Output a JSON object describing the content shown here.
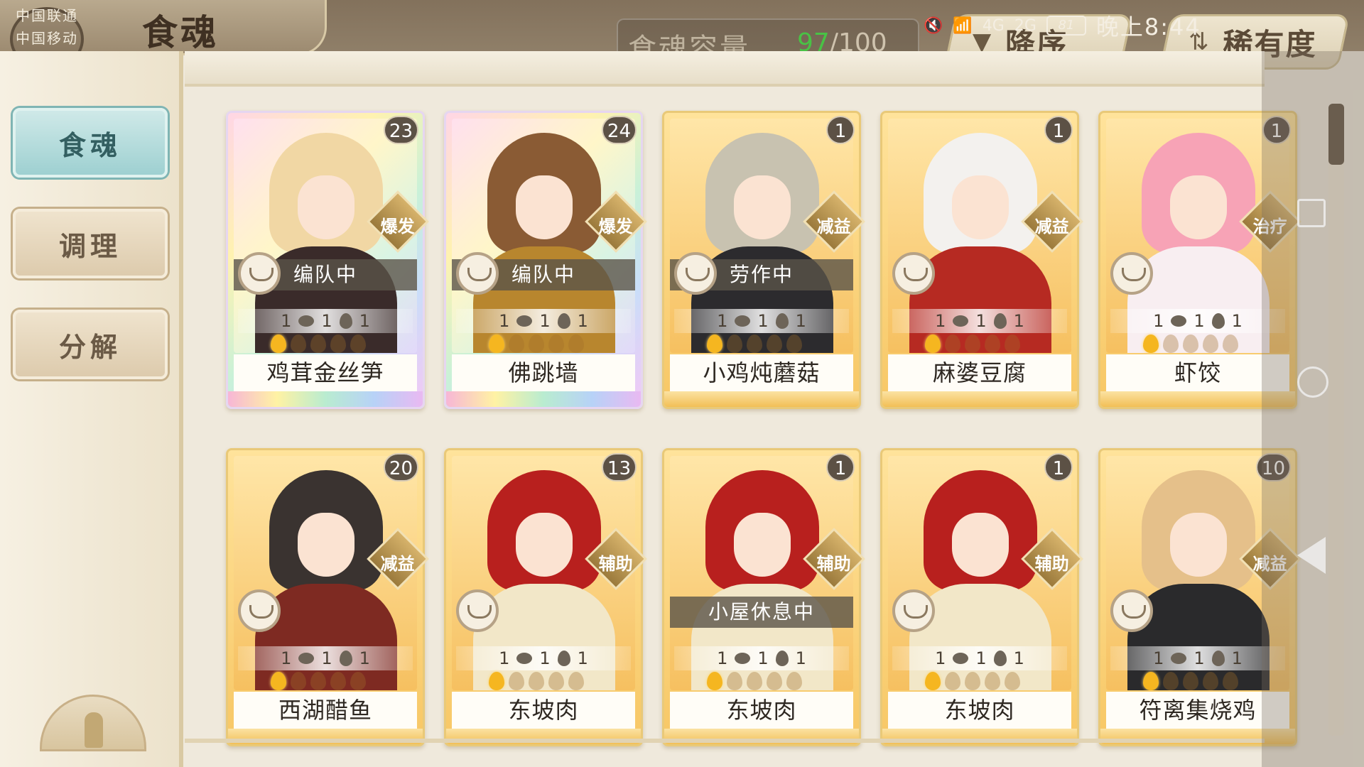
{
  "status_bar": {
    "carrier1": "中国联通",
    "carrier2": "中国移动",
    "net1": "4G",
    "net2": "2G",
    "battery": "81",
    "time": "晚上8:44"
  },
  "header": {
    "title": "食魂",
    "capacity_label": "食魂容量",
    "capacity_current": "97",
    "capacity_max": "/100",
    "sort_order_label": "降序",
    "sort_key_label": "稀有度"
  },
  "sidebar": {
    "items": [
      {
        "label": "食魂",
        "active": true
      },
      {
        "label": "调理",
        "active": false
      },
      {
        "label": "分解",
        "active": false
      }
    ]
  },
  "cards": [
    {
      "name": "鸡茸金丝笋",
      "level": "23",
      "role": "爆发",
      "state": "编队中",
      "stats": [
        "1",
        "1",
        "1"
      ],
      "stars": 1,
      "rarity": "rainbow",
      "hair": "#f1d7a4",
      "body": "#3a2b2a"
    },
    {
      "name": "佛跳墙",
      "level": "24",
      "role": "爆发",
      "state": "编队中",
      "stats": [
        "1",
        "1",
        "1"
      ],
      "stars": 1,
      "rarity": "rainbow",
      "hair": "#8a5b34",
      "body": "#b8862e"
    },
    {
      "name": "小鸡炖蘑菇",
      "level": "1",
      "role": "减益",
      "state": "劳作中",
      "stats": [
        "1",
        "1",
        "1"
      ],
      "stars": 1,
      "rarity": "gold",
      "hair": "#c8c2b0",
      "body": "#2c2b2e"
    },
    {
      "name": "麻婆豆腐",
      "level": "1",
      "role": "减益",
      "state": "",
      "stats": [
        "1",
        "1",
        "1"
      ],
      "stars": 1,
      "rarity": "gold",
      "hair": "#f3f1ee",
      "body": "#b62a22"
    },
    {
      "name": "虾饺",
      "level": "1",
      "role": "治疗",
      "state": "",
      "stats": [
        "1",
        "1",
        "1"
      ],
      "stars": 1,
      "rarity": "gold",
      "hair": "#f7a3b6",
      "body": "#f8eef1"
    },
    {
      "name": "西湖醋鱼",
      "level": "20",
      "role": "减益",
      "state": "",
      "stats": [
        "1",
        "1",
        "1"
      ],
      "stars": 1,
      "rarity": "gold",
      "hair": "#3a3330",
      "body": "#7e2a22"
    },
    {
      "name": "东坡肉",
      "level": "13",
      "role": "辅助",
      "state": "",
      "stats": [
        "1",
        "1",
        "1"
      ],
      "stars": 1,
      "rarity": "gold",
      "hair": "#b8201e",
      "body": "#f2e7c8"
    },
    {
      "name": "东坡肉",
      "level": "1",
      "role": "辅助",
      "state": "小屋休息中",
      "stats": [
        "1",
        "1",
        "1"
      ],
      "stars": 1,
      "rarity": "gold",
      "hair": "#b8201e",
      "body": "#f2e7c8"
    },
    {
      "name": "东坡肉",
      "level": "1",
      "role": "辅助",
      "state": "",
      "stats": [
        "1",
        "1",
        "1"
      ],
      "stars": 1,
      "rarity": "gold",
      "hair": "#b8201e",
      "body": "#f2e7c8"
    },
    {
      "name": "符离集烧鸡",
      "level": "10",
      "role": "减益",
      "state": "",
      "stats": [
        "1",
        "1",
        "1"
      ],
      "stars": 1,
      "rarity": "gold",
      "hair": "#e5c08a",
      "body": "#2a2a2c"
    }
  ]
}
